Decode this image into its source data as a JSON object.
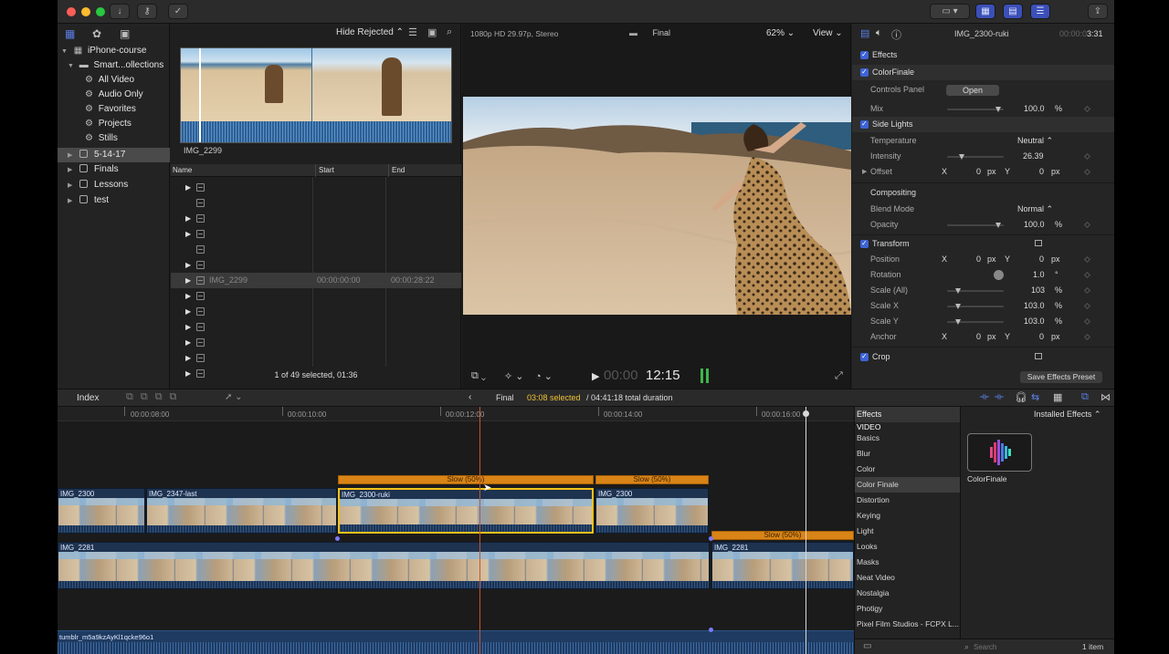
{
  "toolbar": {
    "icons": [
      "download-icon",
      "key-icon",
      "checkmark-icon",
      "display-icon",
      "grid-icon",
      "timeline-layout-icon",
      "inspector-sliders-icon",
      "share-icon"
    ]
  },
  "library": {
    "items": [
      {
        "label": "iPhone-course",
        "icon": "library-icon"
      },
      {
        "label": "Smart...ollections",
        "icon": "folder-icon"
      },
      {
        "label": "All Video",
        "icon": "gear-icon"
      },
      {
        "label": "Audio Only",
        "icon": "gear-icon"
      },
      {
        "label": "Favorites",
        "icon": "gear-icon"
      },
      {
        "label": "Projects",
        "icon": "gear-icon"
      },
      {
        "label": "Stills",
        "icon": "gear-icon"
      },
      {
        "label": "5-14-17",
        "icon": "event-icon"
      },
      {
        "label": "Finals",
        "icon": "event-icon"
      },
      {
        "label": "Lessons",
        "icon": "event-icon"
      },
      {
        "label": "test",
        "icon": "event-icon"
      }
    ]
  },
  "browser": {
    "filter": "Hide Rejected",
    "filmstrip_clip": "IMG_2299",
    "columns": {
      "name": "Name",
      "start": "Start",
      "end": "End"
    },
    "rows": [
      {
        "name": "",
        "start": "",
        "end": ""
      },
      {
        "name": "",
        "start": "",
        "end": ""
      },
      {
        "name": "",
        "start": "",
        "end": ""
      },
      {
        "name": "",
        "start": "",
        "end": ""
      },
      {
        "name": "",
        "start": "",
        "end": ""
      },
      {
        "name": "",
        "start": "",
        "end": ""
      },
      {
        "name": "IMG_2299",
        "start": "00:00:00:00",
        "end": "00:00:28:22"
      },
      {
        "name": "",
        "start": "",
        "end": ""
      },
      {
        "name": "",
        "start": "",
        "end": ""
      },
      {
        "name": "",
        "start": "",
        "end": ""
      },
      {
        "name": "",
        "start": "",
        "end": ""
      },
      {
        "name": "",
        "start": "",
        "end": ""
      },
      {
        "name": "",
        "start": "",
        "end": ""
      }
    ],
    "status": "1 of 49 selected, 01:36"
  },
  "viewer": {
    "format": "1080p HD 29.97p, Stereo",
    "project": "Final",
    "zoom": "62%",
    "view_label": "View",
    "timecode_dim": "00:00",
    "timecode": "12:15"
  },
  "inspector": {
    "clip_name": "IMG_2300-ruki",
    "duration_dim": "00:00:0",
    "duration": "3:31",
    "effects_label": "Effects",
    "colorfinale": {
      "label": "ColorFinale",
      "controls_panel": "Controls Panel",
      "open_button": "Open",
      "mix_label": "Mix",
      "mix_value": "100.0",
      "mix_unit": "%",
      "mix_level": 0.9
    },
    "side_lights": {
      "label": "Side Lights",
      "temperature_label": "Temperature",
      "temperature_value": "Neutral",
      "intensity_label": "Intensity",
      "intensity_value": "26.39",
      "intensity_level": 0.26,
      "offset_label": "Offset",
      "x_label": "X",
      "x_value": "0",
      "y_label": "Y",
      "y_value": "0",
      "unit": "px"
    },
    "compositing": {
      "label": "Compositing",
      "blend_label": "Blend Mode",
      "blend_value": "Normal",
      "opacity_label": "Opacity",
      "opacity_value": "100.0",
      "opacity_unit": "%",
      "opacity_level": 0.9
    },
    "transform": {
      "label": "Transform",
      "position_label": "Position",
      "position_x": "0",
      "position_y": "0",
      "rotation_label": "Rotation",
      "rotation_value": "1.0",
      "rotation_unit": "°",
      "scale_all_label": "Scale (All)",
      "scale_all_value": "103",
      "scale_all_level": 0.2,
      "scale_x_label": "Scale X",
      "scale_x_value": "103.0",
      "scale_x_level": 0.2,
      "scale_y_label": "Scale Y",
      "scale_y_value": "103.0",
      "scale_y_level": 0.2,
      "anchor_label": "Anchor",
      "anchor_x": "0",
      "anchor_y": "0",
      "x_label": "X",
      "y_label": "Y",
      "px": "px",
      "pct": "%"
    },
    "crop": {
      "label": "Crop"
    },
    "save_preset": "Save Effects Preset"
  },
  "timeline_bar": {
    "index": "Index",
    "project": "Final",
    "selected": "03:08 selected",
    "total": "/ 04:41:18 total duration"
  },
  "timeline": {
    "ruler_ticks": [
      "00:00:08:00",
      "00:00:10:00",
      "00:00:12:00",
      "00:00:14:00",
      "00:00:16:00"
    ],
    "clips_top": [
      "IMG_2300",
      "IMG_2347-last",
      "IMG_2300-ruki",
      "IMG_2300"
    ],
    "speed_labels": [
      "Slow (50%)",
      "Slow (50%)",
      "Slow (50%)"
    ],
    "clips_main": [
      "IMG_2281",
      "IMG_2281"
    ],
    "audio_clip": "tumblr_m5a9kzAyKl1qcke96o1"
  },
  "effects": {
    "title": "Effects",
    "installed": "Installed Effects",
    "categories": [
      "VIDEO",
      "Basics",
      "Blur",
      "Color",
      "Color Finale",
      "Distortion",
      "Keying",
      "Light",
      "Looks",
      "Masks",
      "Neat Video",
      "Nostalgia",
      "Photigy",
      "Pixel Film Studios - FCPX L..."
    ],
    "selected_category": "Color Finale",
    "thumbnail_label": "ColorFinale",
    "search_placeholder": "Search",
    "count": "1 item"
  },
  "colors": {
    "accent": "#3d63d6",
    "speed": "#d98417",
    "selection": "#f3c21b",
    "playhead": "#c9552c"
  }
}
